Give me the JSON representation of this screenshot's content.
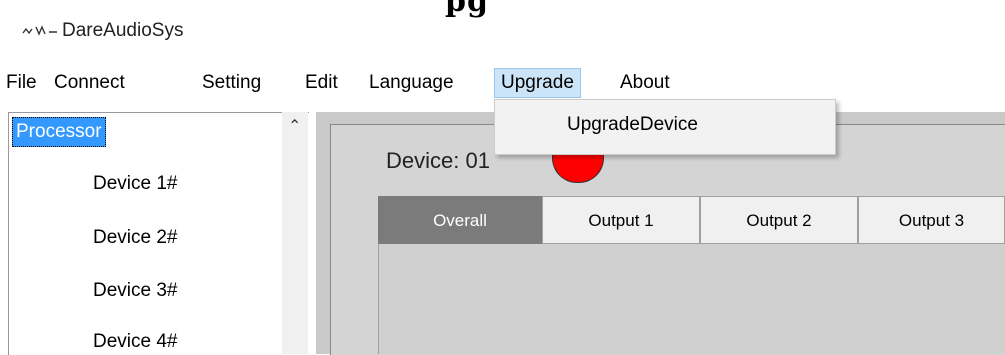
{
  "window": {
    "title": "DareAudioSys",
    "top_fragment": "pg"
  },
  "menu": {
    "items": [
      "File",
      "Connect",
      "Setting",
      "Edit",
      "Language",
      "Upgrade",
      "About"
    ],
    "open_menu": "Upgrade",
    "dropdown_items": [
      "UpgradeDevice"
    ]
  },
  "tree": {
    "root": "Processor",
    "children": [
      "Device 1#",
      "Device 2#",
      "Device 3#",
      "Device 4#"
    ]
  },
  "device_panel": {
    "label": "Device: 01",
    "status_color": "#ff0000",
    "tabs": [
      "Overall",
      "Output 1",
      "Output 2",
      "Output 3"
    ],
    "active_tab": "Overall"
  },
  "colors": {
    "selection": "#3399ff",
    "menu_highlight": "#cce4f7",
    "active_tab": "#7b7b7b"
  }
}
